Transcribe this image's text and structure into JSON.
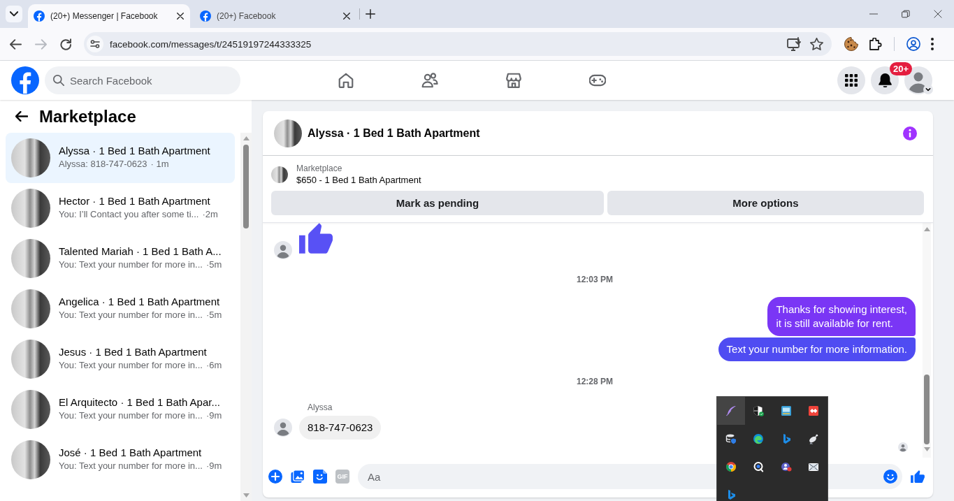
{
  "browser": {
    "tabs": [
      {
        "title": "(20+) Messenger | Facebook",
        "selected": true
      },
      {
        "title": "(20+) Facebook",
        "selected": false
      }
    ],
    "address": "facebook.com/messages/t/24519197244333325"
  },
  "header": {
    "search": {
      "placeholder": "Search Facebook"
    },
    "notifications_badge": "20+"
  },
  "sidebar": {
    "title": "Marketplace",
    "conversations": [
      {
        "title": "Alyssa · 1 Bed 1 Bath Apartment",
        "preview": "Alyssa: 818-747-0623",
        "time": "· 1m",
        "selected": true
      },
      {
        "title": "Hector · 1 Bed 1 Bath Apartment",
        "preview": "You: I’ll Contact you after some ti...",
        "time": "·2m",
        "selected": false
      },
      {
        "title": "Talented Mariah · 1 Bed 1 Bath A...",
        "preview": "You: Text your number for more in...",
        "time": "·5m",
        "selected": false
      },
      {
        "title": "Angelica · 1 Bed 1 Bath Apartment",
        "preview": "You: Text your number for more in...",
        "time": "·5m",
        "selected": false
      },
      {
        "title": "Jesus · 1 Bed 1 Bath Apartment",
        "preview": "You: Text your number for more in...",
        "time": "·6m",
        "selected": false
      },
      {
        "title": "El Arquitecto · 1 Bed 1 Bath Apar...",
        "preview": "You: Text your number for more in...",
        "time": "·9m",
        "selected": false
      },
      {
        "title": "José · 1 Bed 1 Bath Apartment",
        "preview": "You: Text your number for more in...",
        "time": "·9m",
        "selected": false
      }
    ]
  },
  "chat": {
    "title": "Alyssa · 1 Bed 1 Bath Apartment",
    "listing": {
      "label": "Marketplace",
      "title": "$650 - 1 Bed 1 Bath Apartment"
    },
    "actions": [
      "Mark as pending",
      "More options"
    ],
    "messages": [
      {
        "kind": "like"
      },
      {
        "kind": "time",
        "text": "12:03 PM"
      },
      {
        "kind": "outgoing",
        "text": "Thanks for showing interest,\nit is still available for rent."
      },
      {
        "kind": "outgoing",
        "text": "Text your number for more information."
      },
      {
        "kind": "time",
        "text": "12:28 PM"
      },
      {
        "kind": "incoming",
        "sender": "Alyssa",
        "text": "818-747-0623"
      }
    ],
    "read_receipt": true,
    "composer": {
      "placeholder": "Aa",
      "gif_label": "GIF"
    }
  },
  "tray": {
    "items": [
      {
        "kind": "feather",
        "selected": true
      },
      {
        "kind": "shield",
        "selected": false
      },
      {
        "kind": "app-window",
        "selected": false
      },
      {
        "kind": "diamonds",
        "selected": false
      },
      {
        "kind": "database",
        "selected": false
      },
      {
        "kind": "swirl",
        "selected": false
      },
      {
        "kind": "ribbon",
        "selected": false
      },
      {
        "kind": "dish",
        "selected": false
      },
      {
        "kind": "wheel",
        "selected": false
      },
      {
        "kind": "ring",
        "selected": false
      },
      {
        "kind": "people",
        "selected": false
      },
      {
        "kind": "envelope",
        "selected": false
      },
      {
        "kind": "ribbon",
        "selected": false
      }
    ]
  }
}
